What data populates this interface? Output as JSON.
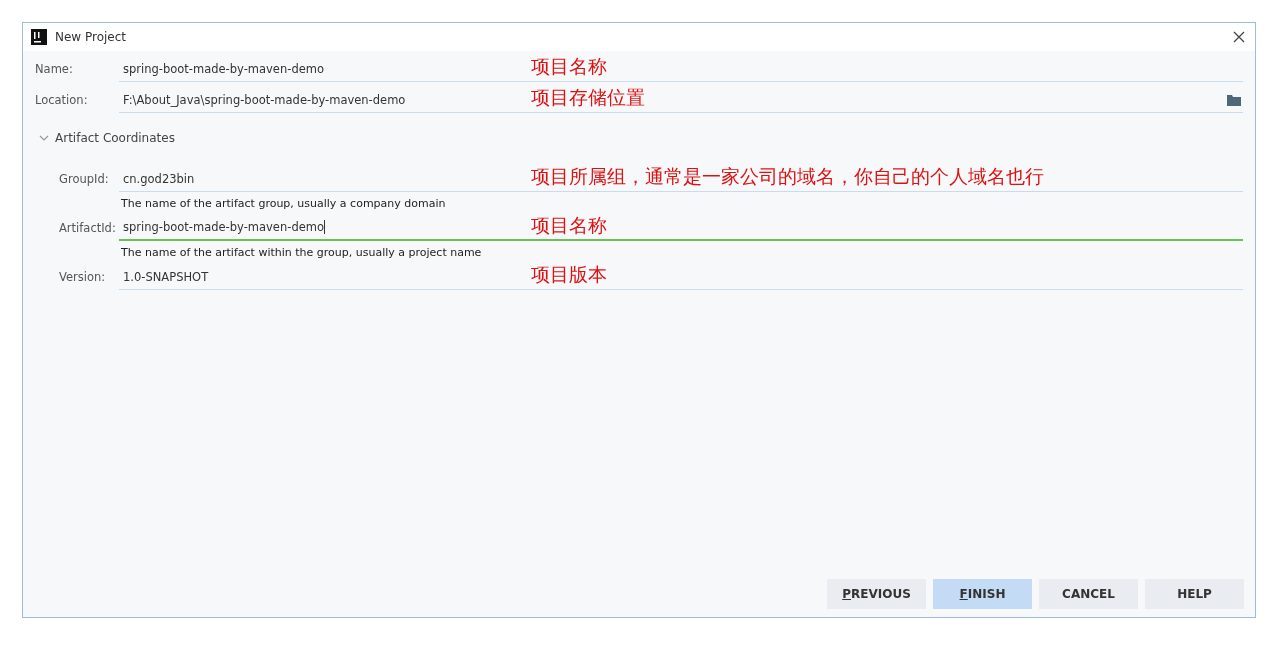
{
  "window": {
    "title": "New Project"
  },
  "fields": [
    {
      "label": "Name:",
      "value": "spring-boot-made-by-maven-demo",
      "annotation": "项目名称",
      "browse": false,
      "focused": false
    },
    {
      "label": "Location:",
      "value": "F:\\About_Java\\spring-boot-made-by-maven-demo",
      "annotation": "项目存储位置",
      "browse": true,
      "focused": false
    }
  ],
  "section": {
    "title": "Artifact Coordinates",
    "expanded": true,
    "fields": [
      {
        "label": "GroupId:",
        "value": "cn.god23bin",
        "annotation": "项目所属组，通常是一家公司的域名，你自己的个人域名也行",
        "hint": "The name of the artifact group, usually a company domain",
        "focused": false
      },
      {
        "label": "ArtifactId:",
        "value": "spring-boot-made-by-maven-demo",
        "annotation": "项目名称",
        "hint": "The name of the artifact within the group, usually a project name",
        "focused": true
      },
      {
        "label": "Version:",
        "value": "1.0-SNAPSHOT",
        "annotation": "项目版本",
        "focused": false
      }
    ]
  },
  "buttons": [
    {
      "label": "PREVIOUS",
      "default": false,
      "mnemonic": true
    },
    {
      "label": "FINISH",
      "default": true,
      "mnemonic": true
    },
    {
      "label": "CANCEL",
      "default": false,
      "mnemonic": false
    },
    {
      "label": "HELP",
      "default": false,
      "mnemonic": false
    }
  ]
}
